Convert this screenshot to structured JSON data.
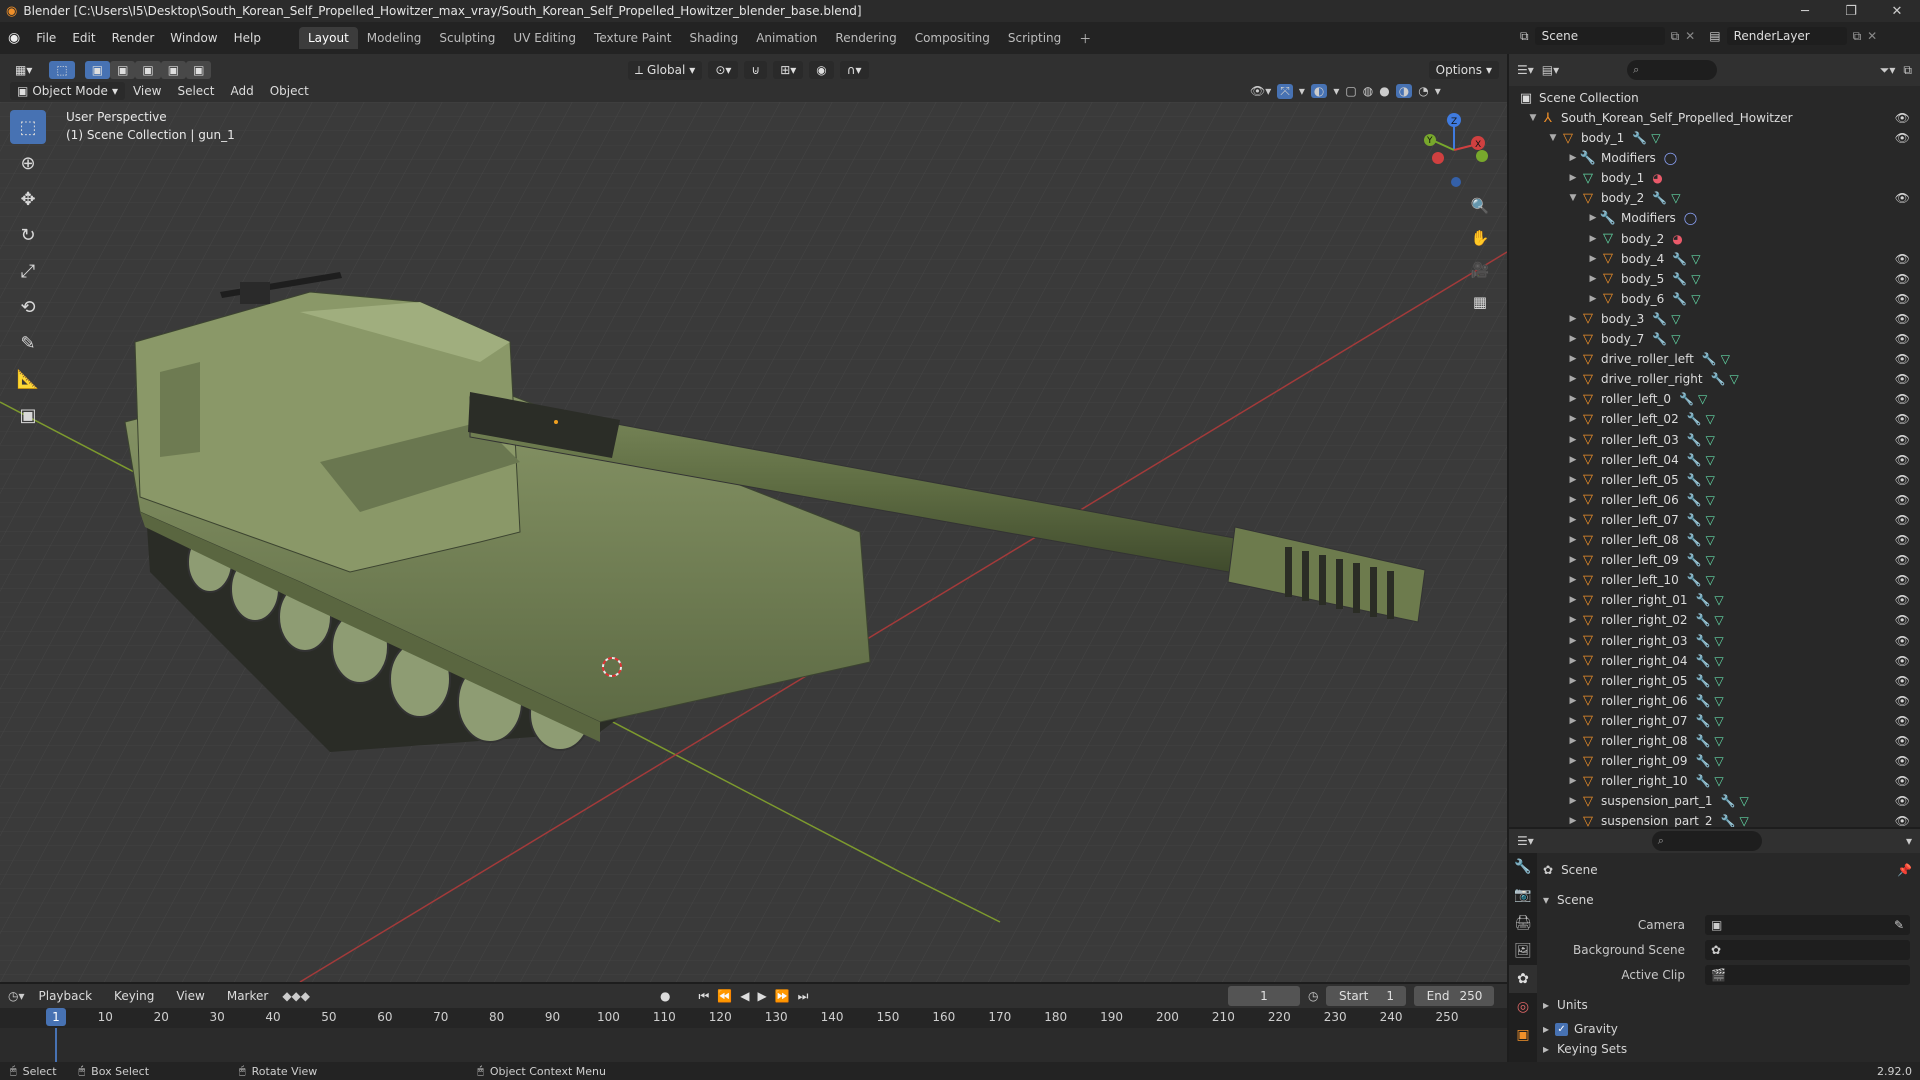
{
  "window": {
    "title": "Blender [C:\\Users\\I5\\Desktop\\South_Korean_Self_Propelled_Howitzer_max_vray/South_Korean_Self_Propelled_Howitzer_blender_base.blend]"
  },
  "menu": [
    "File",
    "Edit",
    "Render",
    "Window",
    "Help"
  ],
  "workspaces": [
    "Layout",
    "Modeling",
    "Sculpting",
    "UV Editing",
    "Texture Paint",
    "Shading",
    "Animation",
    "Rendering",
    "Compositing",
    "Scripting"
  ],
  "active_workspace": "Layout",
  "scene_selector": {
    "scene": "Scene",
    "view_layer": "RenderLayer"
  },
  "viewport_header": {
    "transform_orientation": "Global",
    "options_label": "Options",
    "mode": "Object Mode",
    "menus": [
      "View",
      "Select",
      "Add",
      "Object"
    ]
  },
  "viewport_info": {
    "line1": "User Perspective",
    "line2": "(1) Scene Collection | gun_1"
  },
  "outliner": {
    "root": "Scene Collection",
    "collection": "South_Korean_Self_Propelled_Howitzer",
    "rows": [
      {
        "label": "body_1",
        "type": "object",
        "depth": 2,
        "expanded": true,
        "eye": true
      },
      {
        "label": "Modifiers",
        "type": "modifier",
        "depth": 3,
        "expanded": false,
        "eye": false
      },
      {
        "label": "body_1",
        "type": "mesh",
        "depth": 3,
        "expanded": false,
        "eye": false
      },
      {
        "label": "body_2",
        "type": "object",
        "depth": 3,
        "expanded": true,
        "eye": true
      },
      {
        "label": "Modifiers",
        "type": "modifier",
        "depth": 4,
        "expanded": false,
        "eye": false
      },
      {
        "label": "body_2",
        "type": "mesh",
        "depth": 4,
        "expanded": false,
        "eye": false
      },
      {
        "label": "body_4",
        "type": "object",
        "depth": 4,
        "expanded": false,
        "eye": true
      },
      {
        "label": "body_5",
        "type": "object",
        "depth": 4,
        "expanded": false,
        "eye": true
      },
      {
        "label": "body_6",
        "type": "object",
        "depth": 4,
        "expanded": false,
        "eye": true
      },
      {
        "label": "body_3",
        "type": "object",
        "depth": 3,
        "expanded": false,
        "eye": true
      },
      {
        "label": "body_7",
        "type": "object",
        "depth": 3,
        "expanded": false,
        "eye": true
      },
      {
        "label": "drive_roller_left",
        "type": "object",
        "depth": 3,
        "expanded": false,
        "eye": true
      },
      {
        "label": "drive_roller_right",
        "type": "object",
        "depth": 3,
        "expanded": false,
        "eye": true
      },
      {
        "label": "roller_left_0",
        "type": "object",
        "depth": 3,
        "expanded": false,
        "eye": true
      },
      {
        "label": "roller_left_02",
        "type": "object",
        "depth": 3,
        "expanded": false,
        "eye": true
      },
      {
        "label": "roller_left_03",
        "type": "object",
        "depth": 3,
        "expanded": false,
        "eye": true
      },
      {
        "label": "roller_left_04",
        "type": "object",
        "depth": 3,
        "expanded": false,
        "eye": true
      },
      {
        "label": "roller_left_05",
        "type": "object",
        "depth": 3,
        "expanded": false,
        "eye": true
      },
      {
        "label": "roller_left_06",
        "type": "object",
        "depth": 3,
        "expanded": false,
        "eye": true
      },
      {
        "label": "roller_left_07",
        "type": "object",
        "depth": 3,
        "expanded": false,
        "eye": true
      },
      {
        "label": "roller_left_08",
        "type": "object",
        "depth": 3,
        "expanded": false,
        "eye": true
      },
      {
        "label": "roller_left_09",
        "type": "object",
        "depth": 3,
        "expanded": false,
        "eye": true
      },
      {
        "label": "roller_left_10",
        "type": "object",
        "depth": 3,
        "expanded": false,
        "eye": true
      },
      {
        "label": "roller_right_01",
        "type": "object",
        "depth": 3,
        "expanded": false,
        "eye": true
      },
      {
        "label": "roller_right_02",
        "type": "object",
        "depth": 3,
        "expanded": false,
        "eye": true
      },
      {
        "label": "roller_right_03",
        "type": "object",
        "depth": 3,
        "expanded": false,
        "eye": true
      },
      {
        "label": "roller_right_04",
        "type": "object",
        "depth": 3,
        "expanded": false,
        "eye": true
      },
      {
        "label": "roller_right_05",
        "type": "object",
        "depth": 3,
        "expanded": false,
        "eye": true
      },
      {
        "label": "roller_right_06",
        "type": "object",
        "depth": 3,
        "expanded": false,
        "eye": true
      },
      {
        "label": "roller_right_07",
        "type": "object",
        "depth": 3,
        "expanded": false,
        "eye": true
      },
      {
        "label": "roller_right_08",
        "type": "object",
        "depth": 3,
        "expanded": false,
        "eye": true
      },
      {
        "label": "roller_right_09",
        "type": "object",
        "depth": 3,
        "expanded": false,
        "eye": true
      },
      {
        "label": "roller_right_10",
        "type": "object",
        "depth": 3,
        "expanded": false,
        "eye": true
      },
      {
        "label": "suspension_part_1",
        "type": "object",
        "depth": 3,
        "expanded": false,
        "eye": true
      },
      {
        "label": "suspension_part_2",
        "type": "object",
        "depth": 3,
        "expanded": false,
        "eye": true
      }
    ]
  },
  "properties": {
    "context": "Scene",
    "panel_title": "Scene",
    "fields": [
      {
        "label": "Camera",
        "value": ""
      },
      {
        "label": "Background Scene",
        "value": ""
      },
      {
        "label": "Active Clip",
        "value": ""
      }
    ],
    "subpanels": [
      "Units",
      "Gravity",
      "Keying Sets"
    ],
    "gravity_checked": true
  },
  "timeline": {
    "menus": [
      "Playback",
      "Keying",
      "View",
      "Marker"
    ],
    "current_frame": "1",
    "start_label": "Start",
    "start": "1",
    "end_label": "End",
    "end": "250",
    "ticks": [
      "1",
      "10",
      "20",
      "30",
      "40",
      "50",
      "60",
      "70",
      "80",
      "90",
      "100",
      "110",
      "120",
      "130",
      "140",
      "150",
      "160",
      "170",
      "180",
      "190",
      "200",
      "210",
      "220",
      "230",
      "240",
      "250"
    ]
  },
  "statusbar": {
    "select": "Select",
    "box_select": "Box Select",
    "rotate": "Rotate View",
    "context_menu": "Object Context Menu",
    "version": "2.92.0"
  },
  "colors": {
    "accent": "#4772b3",
    "object_icon": "#f0902a",
    "mesh_icon": "#62d7a5",
    "tank_green": "#6b7a4f"
  }
}
